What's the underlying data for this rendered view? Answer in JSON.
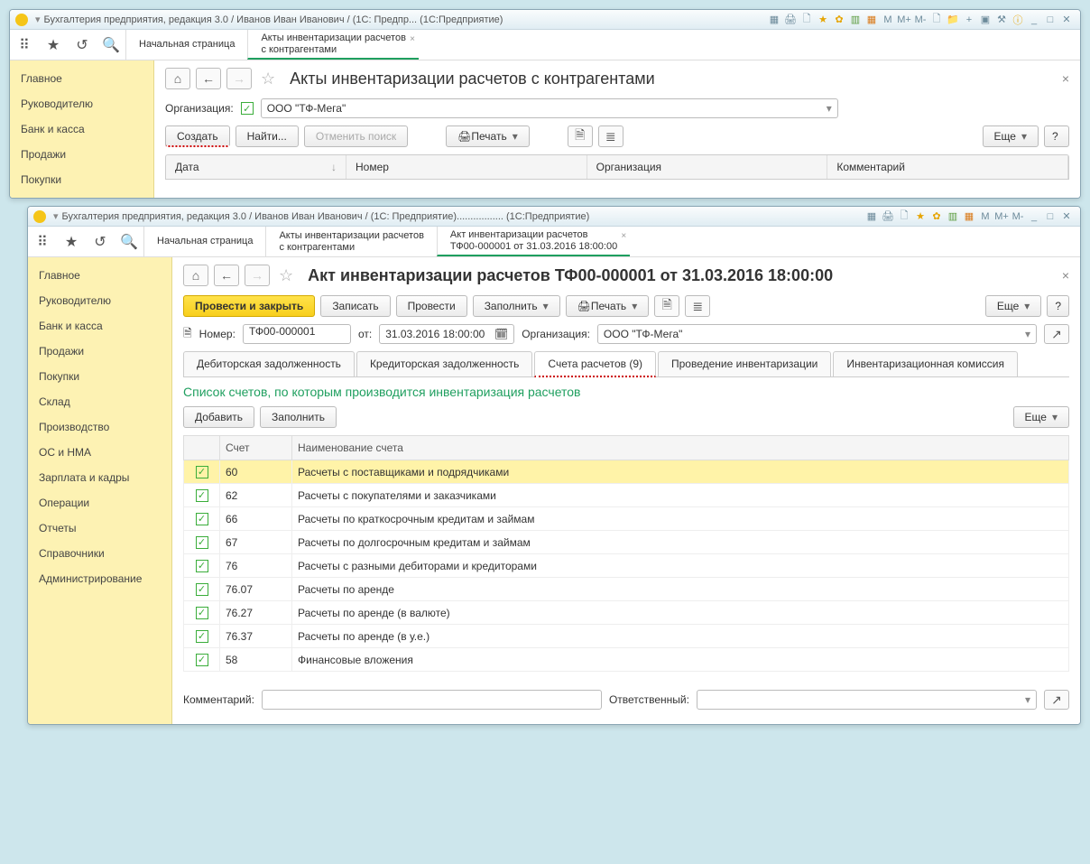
{
  "win1": {
    "title": "Бухгалтерия предприятия, редакция 3.0 / Иванов Иван Иванович / (1С: Предпр... (1С:Предприятие)",
    "tabs": {
      "start": "Начальная страница",
      "acts": {
        "l1": "Акты инвентаризации расчетов",
        "l2": "с контрагентами"
      }
    },
    "sidebar": [
      "Главное",
      "Руководителю",
      "Банк и касса",
      "Продажи",
      "Покупки"
    ],
    "page_title": "Акты инвентаризации расчетов с контрагентами",
    "org_label": "Организация:",
    "org_value": "ООО \"ТФ-Мега\"",
    "buttons": {
      "create": "Создать",
      "find": "Найти...",
      "cancel": "Отменить поиск",
      "print": "Печать",
      "more": "Еще",
      "help": "?"
    },
    "cols": {
      "date": "Дата",
      "number": "Номер",
      "org": "Организация",
      "comment": "Комментарий"
    }
  },
  "win2": {
    "title": "Бухгалтерия предприятия, редакция 3.0 / Иванов Иван Иванович / (1С: Предприятие)................. (1С:Предприятие)",
    "tabs": {
      "start": "Начальная страница",
      "acts": {
        "l1": "Акты инвентаризации расчетов",
        "l2": "с контрагентами"
      },
      "doc": {
        "l1": "Акт инвентаризации расчетов",
        "l2": "ТФ00-000001 от 31.03.2016 18:00:00"
      }
    },
    "sidebar": [
      "Главное",
      "Руководителю",
      "Банк и касса",
      "Продажи",
      "Покупки",
      "Склад",
      "Производство",
      "ОС и НМА",
      "Зарплата и кадры",
      "Операции",
      "Отчеты",
      "Справочники",
      "Администрирование"
    ],
    "page_title": "Акт инвентаризации расчетов ТФ00-000001 от 31.03.2016 18:00:00",
    "buttons": {
      "post_close": "Провести и закрыть",
      "save": "Записать",
      "post": "Провести",
      "fill": "Заполнить",
      "print": "Печать",
      "more": "Еще",
      "help": "?"
    },
    "fields": {
      "num_label": "Номер:",
      "num": "ТФ00-000001",
      "from": "от:",
      "date": "31.03.2016 18:00:00",
      "org_label": "Организация:",
      "org": "ООО \"ТФ-Мега\""
    },
    "doctabs": [
      "Дебиторская задолженность",
      "Кредиторская задолженность",
      "Счета расчетов (9)",
      "Проведение инвентаризации",
      "Инвентаризационная комиссия"
    ],
    "heading": "Список счетов, по которым производится инвентаризация расчетов",
    "tbuttons": {
      "add": "Добавить",
      "fill": "Заполнить",
      "more": "Еще"
    },
    "thead": {
      "account": "Счет",
      "name": "Наименование счета"
    },
    "rows": [
      {
        "a": "60",
        "n": "Расчеты с поставщиками и подрядчиками",
        "sel": true
      },
      {
        "a": "62",
        "n": "Расчеты с покупателями и заказчиками"
      },
      {
        "a": "66",
        "n": "Расчеты по краткосрочным кредитам и займам"
      },
      {
        "a": "67",
        "n": "Расчеты по долгосрочным кредитам и займам"
      },
      {
        "a": "76",
        "n": "Расчеты с разными дебиторами и кредиторами"
      },
      {
        "a": "76.07",
        "n": "Расчеты по аренде"
      },
      {
        "a": "76.27",
        "n": "Расчеты по аренде (в валюте)"
      },
      {
        "a": "76.37",
        "n": "Расчеты по аренде (в у.е.)"
      },
      {
        "a": "58",
        "n": "Финансовые вложения"
      }
    ],
    "footer": {
      "comment": "Комментарий:",
      "resp": "Ответственный:"
    }
  },
  "titlebar_marks": {
    "m": "M",
    "mp": "M+",
    "mm": "M-"
  }
}
